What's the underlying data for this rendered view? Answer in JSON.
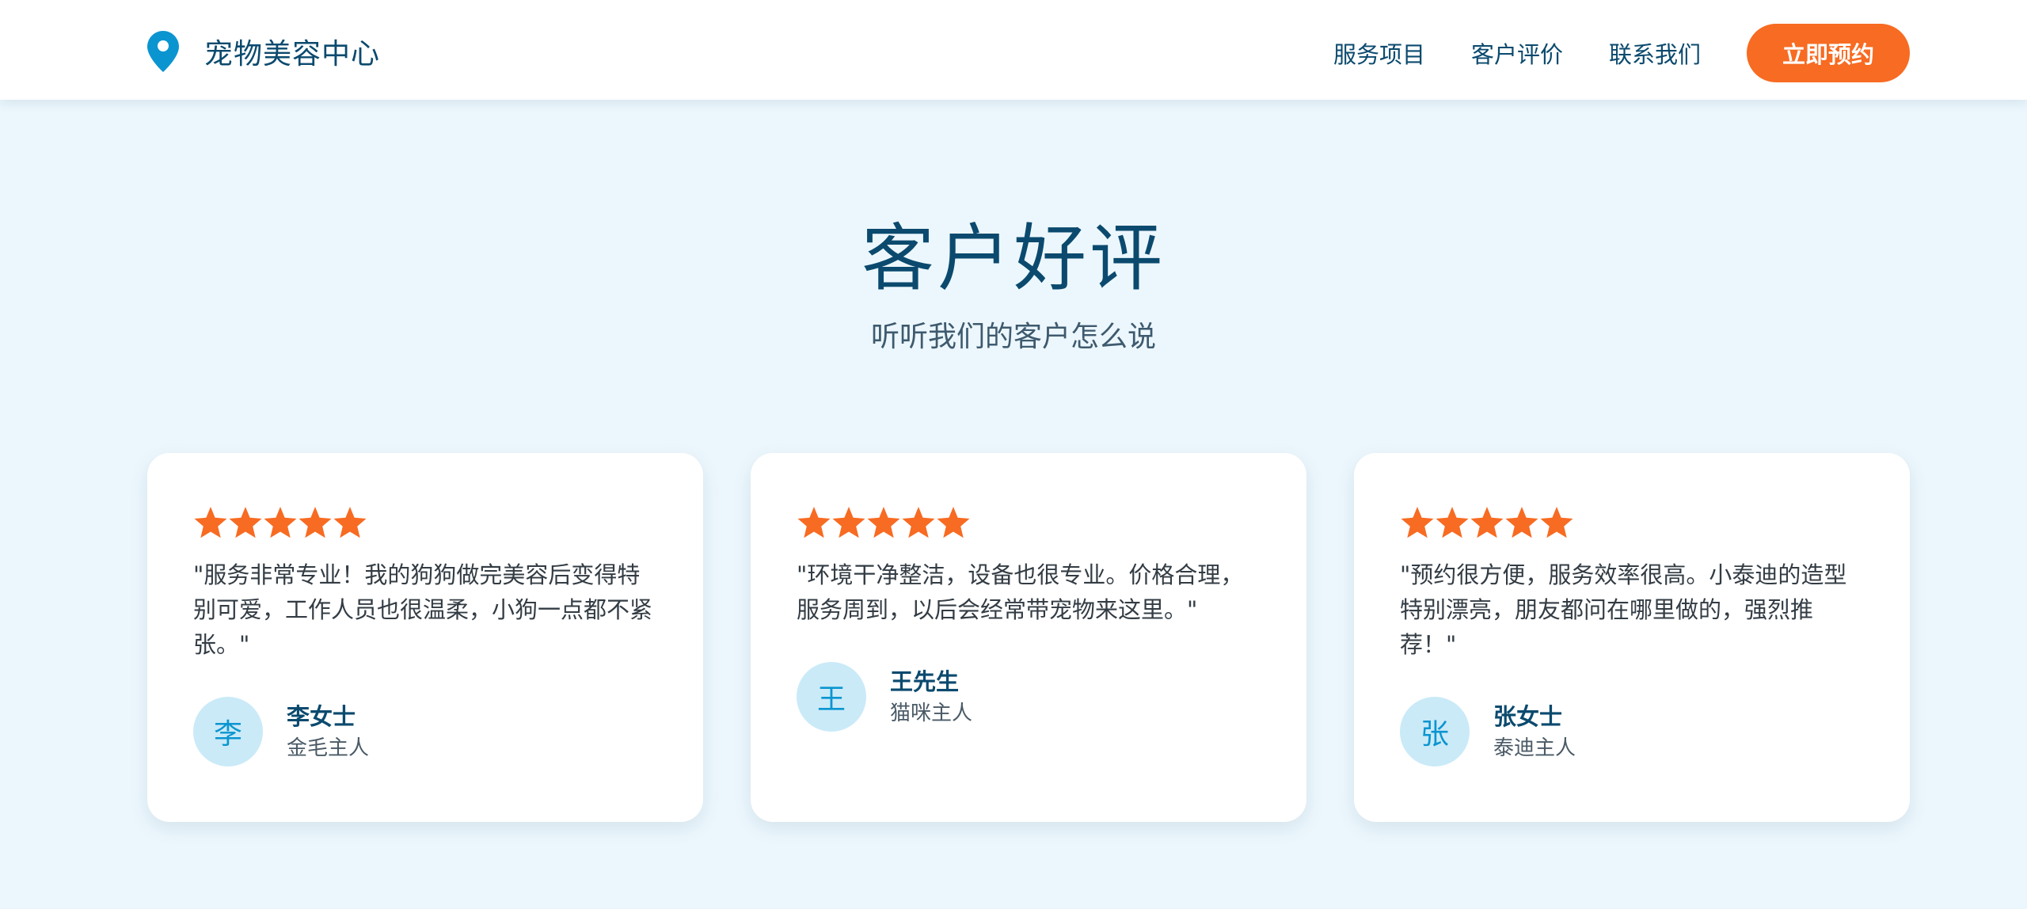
{
  "header": {
    "brand_name": "宠物美容中心",
    "brand_icon": "location-pin-icon",
    "nav": [
      {
        "label": "服务项目"
      },
      {
        "label": "客户评价"
      },
      {
        "label": "联系我们"
      }
    ],
    "cta_label": "立即预约"
  },
  "section": {
    "title": "客户好评",
    "subtitle": "听听我们的客户怎么说"
  },
  "testimonials": [
    {
      "rating": 5,
      "quote": "\"服务非常专业！我的狗狗做完美容后变得特别可爱，工作人员也很温柔，小狗一点都不紧张。\"",
      "avatar_initial": "李",
      "name": "李女士",
      "role": "金毛主人"
    },
    {
      "rating": 5,
      "quote": "\"环境干净整洁，设备也很专业。价格合理，服务周到，以后会经常带宠物来这里。\"",
      "avatar_initial": "王",
      "name": "王先生",
      "role": "猫咪主人"
    },
    {
      "rating": 5,
      "quote": "\"预约很方便，服务效率很高。小泰迪的造型特别漂亮，朋友都问在哪里做的，强烈推荐！\"",
      "avatar_initial": "张",
      "name": "张女士",
      "role": "泰迪主人"
    }
  ],
  "colors": {
    "accent": "#f76b22",
    "primary_text": "#0b4a6e",
    "brand_icon": "#0b95d0",
    "background": "#ecf7fd",
    "avatar_bg": "#caeaf8"
  }
}
